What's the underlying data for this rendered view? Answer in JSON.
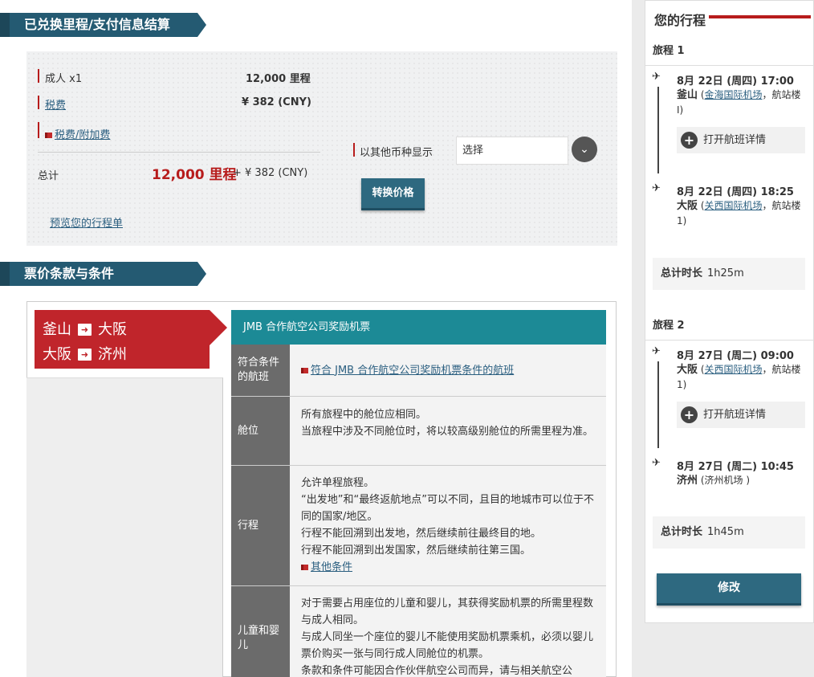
{
  "payment": {
    "heading": "已兑换里程/支付信息结算",
    "adult_label": "成人 x1",
    "adult_value": "12,000 里程",
    "tax_label": "税费",
    "tax_value": "¥ 382 (CNY)",
    "surcharge_link": "税费/附加费",
    "total_label": "总计",
    "total_miles": "12,000 里程",
    "total_extra": "+ ¥ 382 (CNY)",
    "preview_link": "预览您的行程单",
    "currency_label": "以其他币种显示",
    "currency_select_value": "选择",
    "convert_button": "转换价格"
  },
  "terms": {
    "heading": "票价条款与条件",
    "routes": [
      {
        "from": "釜山",
        "to": "大阪"
      },
      {
        "from": "大阪",
        "to": "济州"
      }
    ],
    "table_title": "JMB 合作航空公司奖励机票",
    "rows": [
      {
        "header": "符合条件的航班",
        "lines": [],
        "link": "符合 JMB 合作航空公司奖励机票条件的航班"
      },
      {
        "header": "舱位",
        "lines": [
          "所有旅程中的舱位应相同。",
          "当旅程中涉及不同舱位时，将以较高级别舱位的所需里程为准。"
        ],
        "link": ""
      },
      {
        "header": "行程",
        "lines": [
          "允许单程旅程。",
          "“出发地”和“最终返航地点”可以不同，且目的地城市可以位于不同的国家/地区。",
          "行程不能回溯到出发地，然后继续前往最终目的地。",
          "行程不能回溯到出发国家，然后继续前往第三国。"
        ],
        "link": "其他条件"
      },
      {
        "header": "儿童和婴儿",
        "lines": [
          "对于需要占用座位的儿童和婴儿，其获得奖励机票的所需里程数与成人相同。",
          "与成人同坐一个座位的婴儿不能使用奖励机票乘机，必须以婴儿票价购买一张与同行成人同舱位的机票。",
          "条款和条件可能因合作伙伴航空公司而异，请与相关航空公"
        ],
        "link": ""
      }
    ]
  },
  "itinerary": {
    "title": "您的行程",
    "trips": [
      {
        "name": "旅程 1",
        "dep_time": "8月 22日 (周四) 17:00",
        "dep_city": "釜山",
        "dep_airport": "金海国际机场",
        "dep_terminal": "，航站楼 I)",
        "details_button": "打开航班详情",
        "arr_time": "8月 22日 (周四) 18:25",
        "arr_city": "大阪",
        "arr_airport": "关西国际机场",
        "arr_terminal": "，航站楼 1)",
        "duration_label": "总计时长",
        "duration": "1h25m"
      },
      {
        "name": "旅程 2",
        "dep_time": "8月 27日 (周二) 09:00",
        "dep_city": "大阪",
        "dep_airport": "关西国际机场",
        "dep_terminal": "，航站楼 1)",
        "details_button": "打开航班详情",
        "arr_time": "8月 27日 (周二) 10:45",
        "arr_city": "济州",
        "arr_airport": "(济州机场 )",
        "arr_terminal": "",
        "duration_label": "总计时长",
        "duration": "1h45m"
      }
    ],
    "modify_button": "修改"
  },
  "colors": {
    "accent_red": "#c0252b",
    "header_teal": "#245a72",
    "table_teal": "#1c8a96"
  },
  "icons": [
    "takeoff-plane-icon",
    "landing-plane-icon",
    "plus-circle-icon",
    "chevron-down-icon",
    "arrow-right-icon",
    "link-marker-icon"
  ]
}
